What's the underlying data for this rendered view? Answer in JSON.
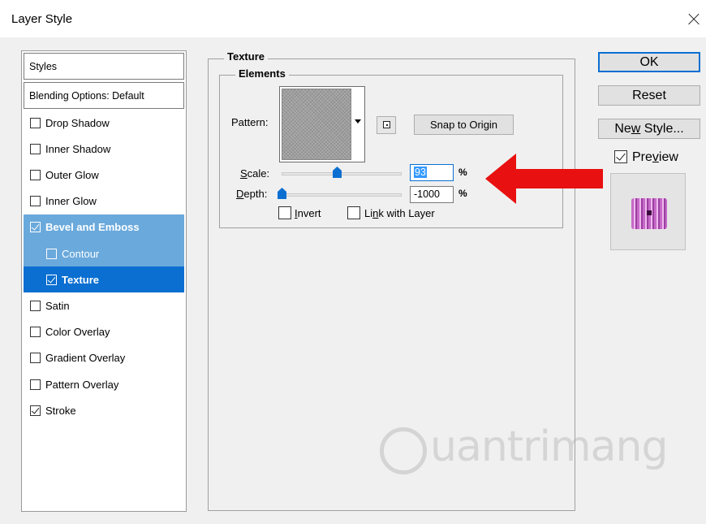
{
  "window": {
    "title": "Layer Style",
    "close_icon": "close-icon"
  },
  "styles_panel": {
    "header": "Styles",
    "blending": "Blending Options: Default",
    "items": [
      {
        "label": "Drop Shadow",
        "checked": false
      },
      {
        "label": "Inner Shadow",
        "checked": false
      },
      {
        "label": "Outer Glow",
        "checked": false
      },
      {
        "label": "Inner Glow",
        "checked": false
      },
      {
        "label": "Bevel and Emboss",
        "checked": true,
        "state": "selected-parent"
      },
      {
        "label": "Contour",
        "checked": false,
        "state": "sub"
      },
      {
        "label": "Texture",
        "checked": true,
        "state": "sub-active"
      },
      {
        "label": "Satin",
        "checked": false
      },
      {
        "label": "Color Overlay",
        "checked": false
      },
      {
        "label": "Gradient Overlay",
        "checked": false
      },
      {
        "label": "Pattern Overlay",
        "checked": false
      },
      {
        "label": "Stroke",
        "checked": true
      }
    ]
  },
  "texture": {
    "group_title": "Texture",
    "elements_title": "Elements",
    "pattern_label": "Pattern:",
    "snap_button": "Snap to Origin",
    "scale_label": "Scale:",
    "scale_value": "93",
    "scale_fraction": 0.46,
    "depth_label": "Depth:",
    "depth_value": "-1000",
    "depth_fraction": 0.0,
    "percent_sign": "%",
    "invert_label": "Invert",
    "invert_checked": false,
    "link_label": "Link with Layer",
    "link_checked": false
  },
  "actions": {
    "ok": "OK",
    "reset": "Reset",
    "new_style": "New Style...",
    "preview_label": "Preview",
    "preview_checked": true
  },
  "watermark": "uantrimang",
  "colors": {
    "selection_light": "#6aa9dc",
    "selection_active": "#0a6fd1",
    "arrow": "#e81010"
  }
}
